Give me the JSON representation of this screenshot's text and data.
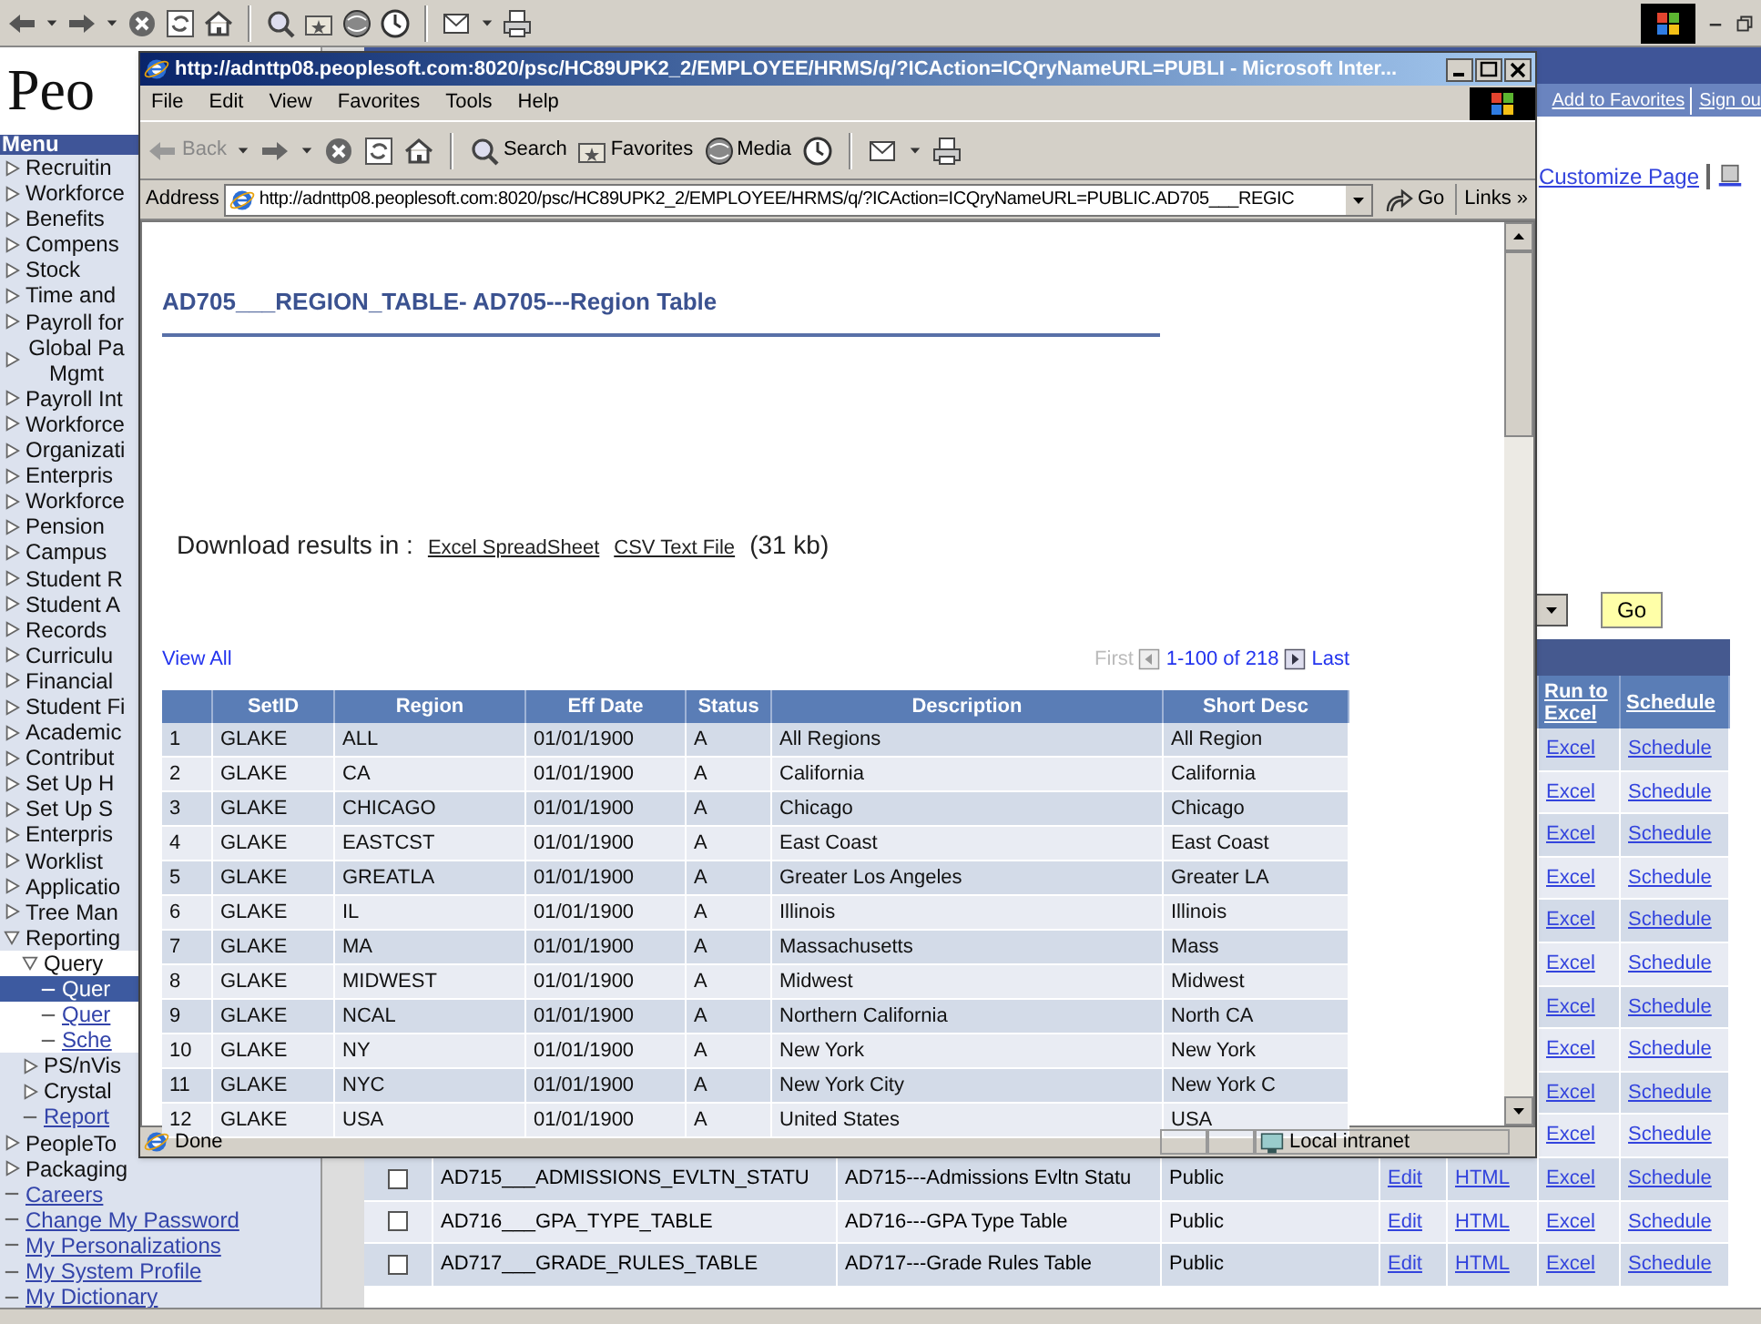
{
  "page": {
    "logo": "Peo",
    "menu": {
      "title": "Menu",
      "items": [
        {
          "label": "Recruitin",
          "kind": "folder",
          "expanded": false
        },
        {
          "label": "Workforce",
          "kind": "folder",
          "expanded": false
        },
        {
          "label": "Benefits",
          "kind": "folder",
          "expanded": false
        },
        {
          "label": "Compens",
          "kind": "folder",
          "expanded": false
        },
        {
          "label": "Stock",
          "kind": "folder",
          "expanded": false
        },
        {
          "label": "Time and",
          "kind": "folder",
          "expanded": false
        },
        {
          "label": "Payroll for",
          "kind": "folder",
          "expanded": false
        },
        {
          "label": "Global Pa Mgmt",
          "kind": "folder",
          "expanded": false
        },
        {
          "label": "Payroll Int",
          "kind": "folder",
          "expanded": false
        },
        {
          "label": "Workforce",
          "kind": "folder",
          "expanded": false
        },
        {
          "label": "Organizati",
          "kind": "folder",
          "expanded": false
        },
        {
          "label": "Enterpris",
          "kind": "folder",
          "expanded": false
        },
        {
          "label": "Workforce",
          "kind": "folder",
          "expanded": false
        },
        {
          "label": "Pension",
          "kind": "folder",
          "expanded": false
        },
        {
          "label": "Campus",
          "kind": "folder",
          "expanded": false
        },
        {
          "label": "Student R",
          "kind": "folder",
          "expanded": false
        },
        {
          "label": "Student A",
          "kind": "folder",
          "expanded": false
        },
        {
          "label": "Records",
          "kind": "folder",
          "expanded": false
        },
        {
          "label": "Curriculu",
          "kind": "folder",
          "expanded": false
        },
        {
          "label": "Financial",
          "kind": "folder",
          "expanded": false
        },
        {
          "label": "Student Fi",
          "kind": "folder",
          "expanded": false
        },
        {
          "label": "Academic",
          "kind": "folder",
          "expanded": false
        },
        {
          "label": "Contribut",
          "kind": "folder",
          "expanded": false
        },
        {
          "label": "Set Up H",
          "kind": "folder",
          "expanded": false
        },
        {
          "label": "Set Up S",
          "kind": "folder",
          "expanded": false
        },
        {
          "label": "Enterpris",
          "kind": "folder",
          "expanded": false
        },
        {
          "label": "Worklist",
          "kind": "folder",
          "expanded": false
        },
        {
          "label": "Applicatio",
          "kind": "folder",
          "expanded": false
        },
        {
          "label": "Tree Man",
          "kind": "folder",
          "expanded": false
        },
        {
          "label": "Reporting",
          "kind": "folder",
          "expanded": true,
          "children": [
            {
              "label": "Query",
              "kind": "folder",
              "expanded": true,
              "children": [
                {
                  "label": "Quer",
                  "kind": "link",
                  "selected": true
                },
                {
                  "label": "Quer",
                  "kind": "link",
                  "selected": false
                },
                {
                  "label": "Sche",
                  "kind": "link",
                  "selected": false
                }
              ]
            },
            {
              "label": "PS/nVis",
              "kind": "folder",
              "expanded": false
            },
            {
              "label": "Crystal",
              "kind": "folder",
              "expanded": false
            },
            {
              "label": "Report",
              "kind": "link",
              "selected": false
            }
          ]
        },
        {
          "label": "PeopleTo",
          "kind": "folder",
          "expanded": false
        },
        {
          "label": "Packaging",
          "kind": "folder",
          "expanded": false
        },
        {
          "label": "Careers",
          "kind": "link",
          "selected": false
        },
        {
          "label": "Change My Password",
          "kind": "link",
          "selected": false
        },
        {
          "label": "My Personalizations",
          "kind": "link",
          "selected": false
        },
        {
          "label": "My System Profile",
          "kind": "link",
          "selected": false
        },
        {
          "label": "My Dictionary",
          "kind": "link",
          "selected": false
        }
      ]
    },
    "nav_links": [
      "Add to Favorites",
      "Sign ou"
    ],
    "customize_link": "Customize Page",
    "go_button": "Go",
    "table": {
      "columns": [
        "Run to Excel",
        "Schedule"
      ],
      "rows": [
        {
          "excel": "Excel",
          "schedule": "Schedule"
        },
        {
          "excel": "Excel",
          "schedule": "Schedule"
        },
        {
          "excel": "Excel",
          "schedule": "Schedule"
        },
        {
          "excel": "Excel",
          "schedule": "Schedule"
        },
        {
          "excel": "Excel",
          "schedule": "Schedule"
        },
        {
          "excel": "Excel",
          "schedule": "Schedule"
        },
        {
          "excel": "Excel",
          "schedule": "Schedule"
        },
        {
          "excel": "Excel",
          "schedule": "Schedule"
        },
        {
          "excel": "Excel",
          "schedule": "Schedule"
        },
        {
          "excel": "Excel",
          "schedule": "Schedule"
        },
        {
          "checked": false,
          "name": "AD715___ADMISSIONS_EVLTN_STATU",
          "description": "AD715---Admissions Evltn Statu",
          "access": "Public",
          "edit": "Edit",
          "html": "HTML",
          "excel": "Excel",
          "schedule": "Schedule"
        },
        {
          "checked": false,
          "name": "AD716___GPA_TYPE_TABLE",
          "description": "AD716---GPA Type Table",
          "access": "Public",
          "edit": "Edit",
          "html": "HTML",
          "excel": "Excel",
          "schedule": "Schedule"
        },
        {
          "checked": false,
          "name": "AD717___GRADE_RULES_TABLE",
          "description": "AD717---Grade Rules Table",
          "access": "Public",
          "edit": "Edit",
          "html": "HTML",
          "excel": "Excel",
          "schedule": "Schedule"
        }
      ]
    }
  },
  "popup": {
    "title": "http://adnttp08.peoplesoft.com:8020/psc/HC89UPK2_2/EMPLOYEE/HRMS/q/?ICAction=ICQryNameURL=PUBLI - Microsoft Inter...",
    "menu": [
      "File",
      "Edit",
      "View",
      "Favorites",
      "Tools",
      "Help"
    ],
    "toolbar": {
      "back": "Back",
      "search": "Search",
      "favorites": "Favorites",
      "media": "Media"
    },
    "address": {
      "label": "Address",
      "value": "http://adnttp08.peoplesoft.com:8020/psc/HC89UPK2_2/EMPLOYEE/HRMS/q/?ICAction=ICQryNameURL=PUBLIC.AD705___REGIC",
      "go": "Go",
      "links": "Links »"
    },
    "content": {
      "heading": "AD705___REGION_TABLE- AD705---Region Table",
      "download": {
        "label": "Download results in :",
        "links": [
          "Excel SpreadSheet",
          "CSV Text File"
        ],
        "size": "(31 kb)"
      },
      "view_all": "View All",
      "pagination": {
        "first": "First",
        "range": "1-100 of 218",
        "last": "Last"
      },
      "table": {
        "columns": [
          "",
          "SetID",
          "Region",
          "Eff Date",
          "Status",
          "Description",
          "Short Desc"
        ],
        "rows": [
          [
            "1",
            "GLAKE",
            "ALL",
            "01/01/1900",
            "A",
            "All Regions",
            "All Region"
          ],
          [
            "2",
            "GLAKE",
            "CA",
            "01/01/1900",
            "A",
            "California",
            "California"
          ],
          [
            "3",
            "GLAKE",
            "CHICAGO",
            "01/01/1900",
            "A",
            "Chicago",
            "Chicago"
          ],
          [
            "4",
            "GLAKE",
            "EASTCST",
            "01/01/1900",
            "A",
            "East Coast",
            "East Coast"
          ],
          [
            "5",
            "GLAKE",
            "GREATLA",
            "01/01/1900",
            "A",
            "Greater Los Angeles",
            "Greater LA"
          ],
          [
            "6",
            "GLAKE",
            "IL",
            "01/01/1900",
            "A",
            "Illinois",
            "Illinois"
          ],
          [
            "7",
            "GLAKE",
            "MA",
            "01/01/1900",
            "A",
            "Massachusetts",
            "Mass"
          ],
          [
            "8",
            "GLAKE",
            "MIDWEST",
            "01/01/1900",
            "A",
            "Midwest",
            "Midwest"
          ],
          [
            "9",
            "GLAKE",
            "NCAL",
            "01/01/1900",
            "A",
            "Northern California",
            "North CA"
          ],
          [
            "10",
            "GLAKE",
            "NY",
            "01/01/1900",
            "A",
            "New York",
            "New York"
          ],
          [
            "11",
            "GLAKE",
            "NYC",
            "01/01/1900",
            "A",
            "New York City",
            "New York C"
          ],
          [
            "12",
            "GLAKE",
            "USA",
            "01/01/1900",
            "A",
            "United States",
            "USA"
          ]
        ]
      }
    },
    "status": {
      "text": "Done",
      "zone": "Local intranet"
    }
  }
}
